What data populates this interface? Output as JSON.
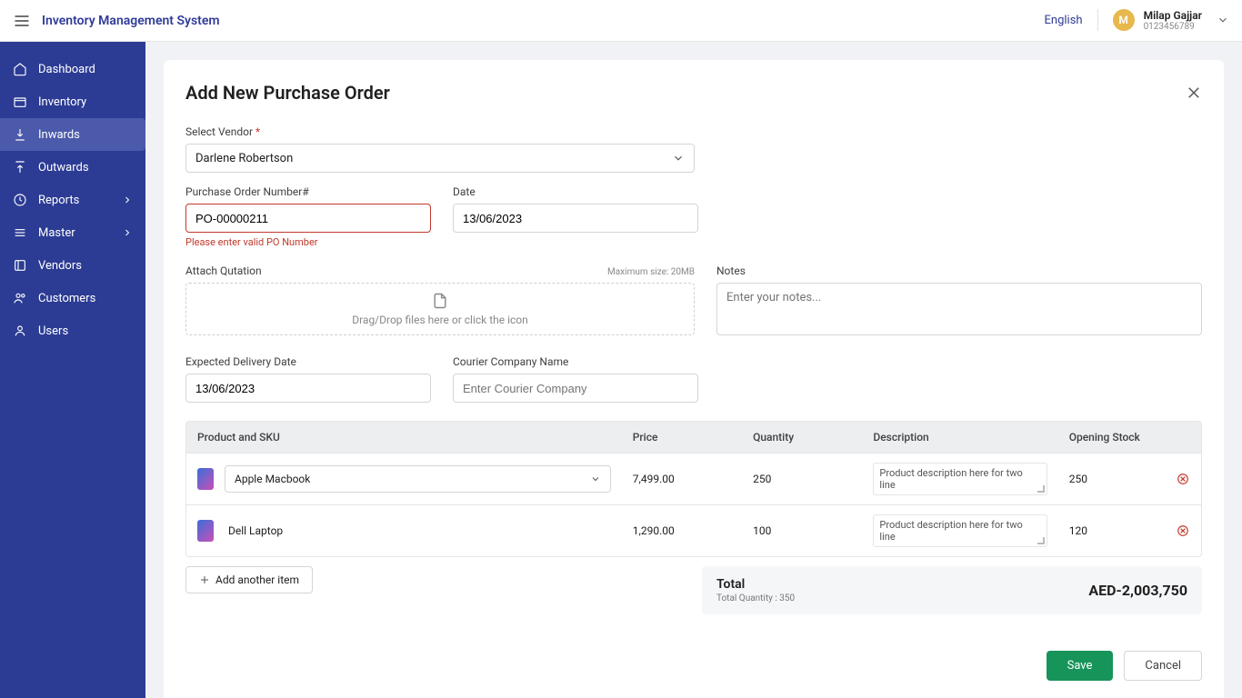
{
  "header": {
    "app_title": "Inventory Management System",
    "language": "English",
    "avatar_initial": "M",
    "user_name": "Milap Gajjar",
    "user_id": "0123456789"
  },
  "sidebar": {
    "items": [
      {
        "label": "Dashboard",
        "active": false,
        "expandable": false
      },
      {
        "label": "Inventory",
        "active": false,
        "expandable": false
      },
      {
        "label": "Inwards",
        "active": true,
        "expandable": false
      },
      {
        "label": "Outwards",
        "active": false,
        "expandable": false
      },
      {
        "label": "Reports",
        "active": false,
        "expandable": true
      },
      {
        "label": "Master",
        "active": false,
        "expandable": true
      },
      {
        "label": "Vendors",
        "active": false,
        "expandable": false
      },
      {
        "label": "Customers",
        "active": false,
        "expandable": false
      },
      {
        "label": "Users",
        "active": false,
        "expandable": false
      }
    ]
  },
  "page": {
    "title": "Add New Purchase Order",
    "vendor_label": "Select Vendor",
    "vendor_value": "Darlene Robertson",
    "po_label": "Purchase Order Number#",
    "po_value": "PO-00000211",
    "po_error": "Please enter valid PO Number",
    "date_label": "Date",
    "date_value": "13/06/2023",
    "attach_label": "Attach Qutation",
    "attach_max": "Maximum size: 20MB",
    "attach_hint": "Drag/Drop files here or click the icon",
    "notes_label": "Notes",
    "notes_placeholder": "Enter your notes...",
    "expected_label": "Expected Delivery Date",
    "expected_value": "13/06/2023",
    "courier_label": "Courier Company Name",
    "courier_placeholder": "Enter Courier Company"
  },
  "table": {
    "headers": {
      "product": "Product and SKU",
      "price": "Price",
      "qty": "Quantity",
      "desc": "Description",
      "open": "Opening Stock"
    },
    "rows": [
      {
        "product": "Apple Macbook",
        "select": true,
        "price": "7,499.00",
        "qty": "250",
        "desc": "Product description here for two line",
        "open": "250"
      },
      {
        "product": "Dell Laptop",
        "select": false,
        "price": "1,290.00",
        "qty": "100",
        "desc": "Product description here for two line",
        "open": "120"
      }
    ],
    "add_item": "Add another item",
    "total_label": "Total",
    "total_qty": "Total Quantity : 350",
    "total_amount": "AED-2,003,750"
  },
  "actions": {
    "save": "Save",
    "cancel": "Cancel"
  }
}
